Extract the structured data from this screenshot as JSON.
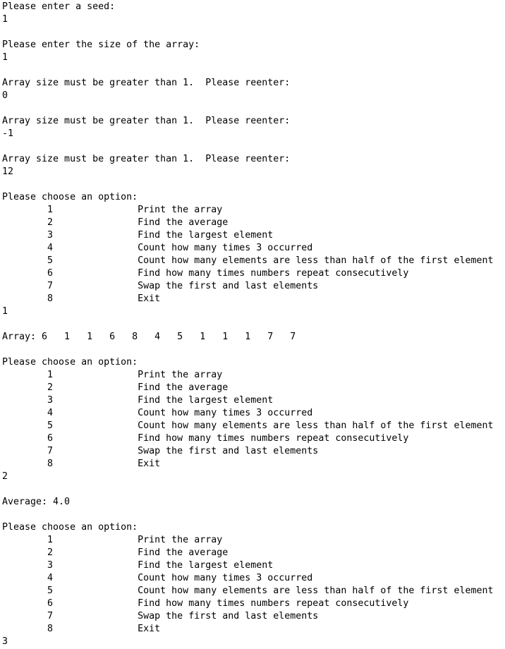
{
  "terminal": {
    "kind": "console-transcript",
    "foreground_color": "#000000",
    "background_color": "#ffffff",
    "prompts": {
      "seed_prompt": "Please enter a seed:",
      "size_prompt": "Please enter the size of the array:",
      "size_error": "Array size must be greater than 1.  Please reenter:",
      "menu_prompt": "Please choose an option:"
    },
    "menu_options": [
      {
        "number": "1",
        "label": "Print the array"
      },
      {
        "number": "2",
        "label": "Find the average"
      },
      {
        "number": "3",
        "label": "Find the largest element"
      },
      {
        "number": "4",
        "label": "Count how many times 3 occurred"
      },
      {
        "number": "5",
        "label": "Count how many elements are less than half of the first element"
      },
      {
        "number": "6",
        "label": "Find how many times numbers repeat consecutively"
      },
      {
        "number": "7",
        "label": "Swap the first and last elements"
      },
      {
        "number": "8",
        "label": "Exit"
      }
    ],
    "user_inputs": {
      "seed": "1",
      "size_attempt_1": "1",
      "size_attempt_2": "0",
      "size_attempt_3": "-1",
      "size_accepted": "12",
      "menu_choice_1": "1",
      "menu_choice_2": "2",
      "menu_choice_3": "3"
    },
    "outputs": {
      "array_label": "Array:",
      "array_values": [
        "6",
        "1",
        "1",
        "6",
        "8",
        "4",
        "5",
        "1",
        "1",
        "1",
        "7",
        "7"
      ],
      "array_line": "Array: 6   1   1   6   8   4   5   1   1   1   7   7",
      "average_label": "Average:",
      "average_value": "4.0",
      "average_line": "Average: 4.0"
    },
    "transcript": "Please enter a seed:\n1\n\nPlease enter the size of the array:\n1\n\nArray size must be greater than 1.  Please reenter:\n0\n\nArray size must be greater than 1.  Please reenter:\n-1\n\nArray size must be greater than 1.  Please reenter:\n12\n\nPlease choose an option:\n\t1\t\tPrint the array\n\t2\t\tFind the average\n\t3\t\tFind the largest element\n\t4\t\tCount how many times 3 occurred\n\t5\t\tCount how many elements are less than half of the first element\n\t6\t\tFind how many times numbers repeat consecutively\n\t7\t\tSwap the first and last elements\n\t8\t\tExit\n1\n\nArray: 6   1   1   6   8   4   5   1   1   1   7   7\n\nPlease choose an option:\n\t1\t\tPrint the array\n\t2\t\tFind the average\n\t3\t\tFind the largest element\n\t4\t\tCount how many times 3 occurred\n\t5\t\tCount how many elements are less than half of the first element\n\t6\t\tFind how many times numbers repeat consecutively\n\t7\t\tSwap the first and last elements\n\t8\t\tExit\n2\n\nAverage: 4.0\n\nPlease choose an option:\n\t1\t\tPrint the array\n\t2\t\tFind the average\n\t3\t\tFind the largest element\n\t4\t\tCount how many times 3 occurred\n\t5\t\tCount how many elements are less than half of the first element\n\t6\t\tFind how many times numbers repeat consecutively\n\t7\t\tSwap the first and last elements\n\t8\t\tExit\n3"
  }
}
